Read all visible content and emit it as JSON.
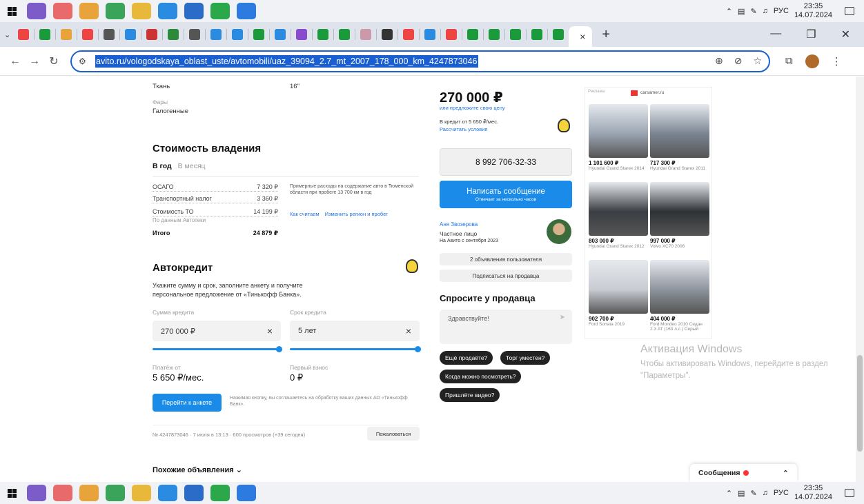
{
  "taskbar": {
    "clock_time": "23:35",
    "clock_date": "14.07.2024",
    "lang": "РУС",
    "apps": [
      {
        "name": "viber-icon",
        "color": "#7b5cc9"
      },
      {
        "name": "flower-icon",
        "color": "#e86a6a"
      },
      {
        "name": "chrome-icon",
        "color": "#e8a33a"
      },
      {
        "name": "excel-icon",
        "color": "#3aa45a"
      },
      {
        "name": "files-icon",
        "color": "#e8b83a"
      },
      {
        "name": "telegram-icon",
        "color": "#2b8be0"
      },
      {
        "name": "notes-icon",
        "color": "#2b6cc9"
      },
      {
        "name": "whatsapp-icon",
        "color": "#2aa84a"
      },
      {
        "name": "app-icon",
        "color": "#2b7be0"
      }
    ]
  },
  "browser": {
    "url": "avito.ru/vologodskaya_oblast_uste/avtomobili/uaz_39094_2.7_mt_2007_178_000_km_4247873046",
    "tab_close": "×",
    "new_tab": "+",
    "tab_favicons": [
      "#e44",
      "#1a9a3a",
      "#e8a33a",
      "#e44",
      "#555",
      "#2b8be0",
      "#c33",
      "#2a8a3a",
      "#555",
      "#2b8be0",
      "#2b8be0",
      "#1a9a3a",
      "#2b8be0",
      "#8a4ad0",
      "#1a9a3a",
      "#1a9a3a",
      "#c9a",
      "#333",
      "#e44",
      "#2b8be0",
      "#e44",
      "#1a9a3a",
      "#1a9a3a",
      "#1a9a3a",
      "#1a9a3a",
      "#1a9a3a"
    ]
  },
  "specs": {
    "upholstery_value": "Ткань",
    "wheels_value": "16\"",
    "headlights_label": "Фары",
    "headlights_value": "Галогенные"
  },
  "ownership": {
    "title": "Стоимость владения",
    "tab_year": "В год",
    "tab_month": "В месяц",
    "rows": [
      {
        "label": "ОСАГО",
        "value": "7 320 ₽"
      },
      {
        "label": "Транспортный налог",
        "value": "3 360 ₽"
      },
      {
        "label": "Стоимость ТО",
        "value": "14 199 ₽"
      }
    ],
    "source": "По данным Автотеки",
    "total_label": "Итого",
    "total_value": "24 879 ₽",
    "note": "Примерные расходы на содержание авто в Тюменской области при пробеге 13 700 км в год",
    "link_how": "Как считаем",
    "link_change": "Изменить регион и пробег"
  },
  "autocredit": {
    "title": "Автокредит",
    "desc": "Укажите сумму и срок, заполните анкету и получите персональное предложение от «Тинькофф Банка».",
    "sum_label": "Сумма кредита",
    "sum_value": "270 000 ₽",
    "term_label": "Срок кредита",
    "term_value": "5 лет",
    "payment_label": "Платёж от",
    "payment_value": "5 650 ₽/мес.",
    "down_label": "Первый взнос",
    "down_value": "0 ₽",
    "apply_button": "Перейти к анкете",
    "consent": "Нажимая кнопку, вы соглашаетесь на обработку ваших данных АО «Тинькофф Банк».",
    "clear": "×"
  },
  "listing_meta": {
    "info": "№ 4247873046 · 7 июля в 13:13 · 600 просмотров (+39 сегодня)",
    "report_button": "Пожаловаться"
  },
  "similar": {
    "label": "Похожие объявления ⌄"
  },
  "sidebar": {
    "price": "270 000 ₽",
    "offer_link": "или предложите свою цену",
    "credit_text": "В кредит от 5 650 ₽/мес.",
    "credit_link": "Рассчитать условия",
    "phone": "8 992 706-32-33",
    "write_button": "Написать сообщение",
    "write_sub": "Отвечает за несколько часов",
    "seller_name": "Аня Звозерова",
    "seller_type": "Частное лицо",
    "seller_since": "На Авито с сентября 2023",
    "seller_listings": "2 объявления пользователя",
    "subscribe": "Подписаться на продавца",
    "ask_title": "Спросите у продавца",
    "ask_placeholder": "Здравствуйте!",
    "chips": [
      "Ещё продаёте?",
      "Торг уместен?",
      "Когда можно посмотреть?",
      "Пришлёте видео?"
    ]
  },
  "ad": {
    "label": "Реклама",
    "brand": "carsamer.ru",
    "items": [
      {
        "price": "1 101 600 ₽",
        "desc": "Hyundai Grand Starex 2014",
        "color": "#9aa4b2"
      },
      {
        "price": "717 300 ₽",
        "desc": "Hyundai Grand Starex 2011",
        "color": "#7a8592"
      },
      {
        "price": "803 000 ₽",
        "desc": "Hyundai Grand Starex 2012",
        "color": "#3a3e44"
      },
      {
        "price": "997 000 ₽",
        "desc": "Volvo XC70 2006",
        "color": "#2e3236"
      },
      {
        "price": "902 700 ₽",
        "desc": "Ford Sonata 2019",
        "color": "#c8ccd2"
      },
      {
        "price": "404 000 ₽",
        "desc": "Ford Mondeo 2010 Седан 2.3 AT (160 л.с.) Серый",
        "color": "#8d949c"
      }
    ]
  },
  "windows": {
    "activation_title": "Активация Windows",
    "activation_sub": "Чтобы активировать Windows, перейдите в раздел \"Параметры\"."
  },
  "messages": {
    "label": "Сообщения",
    "chevron": "⌃"
  }
}
